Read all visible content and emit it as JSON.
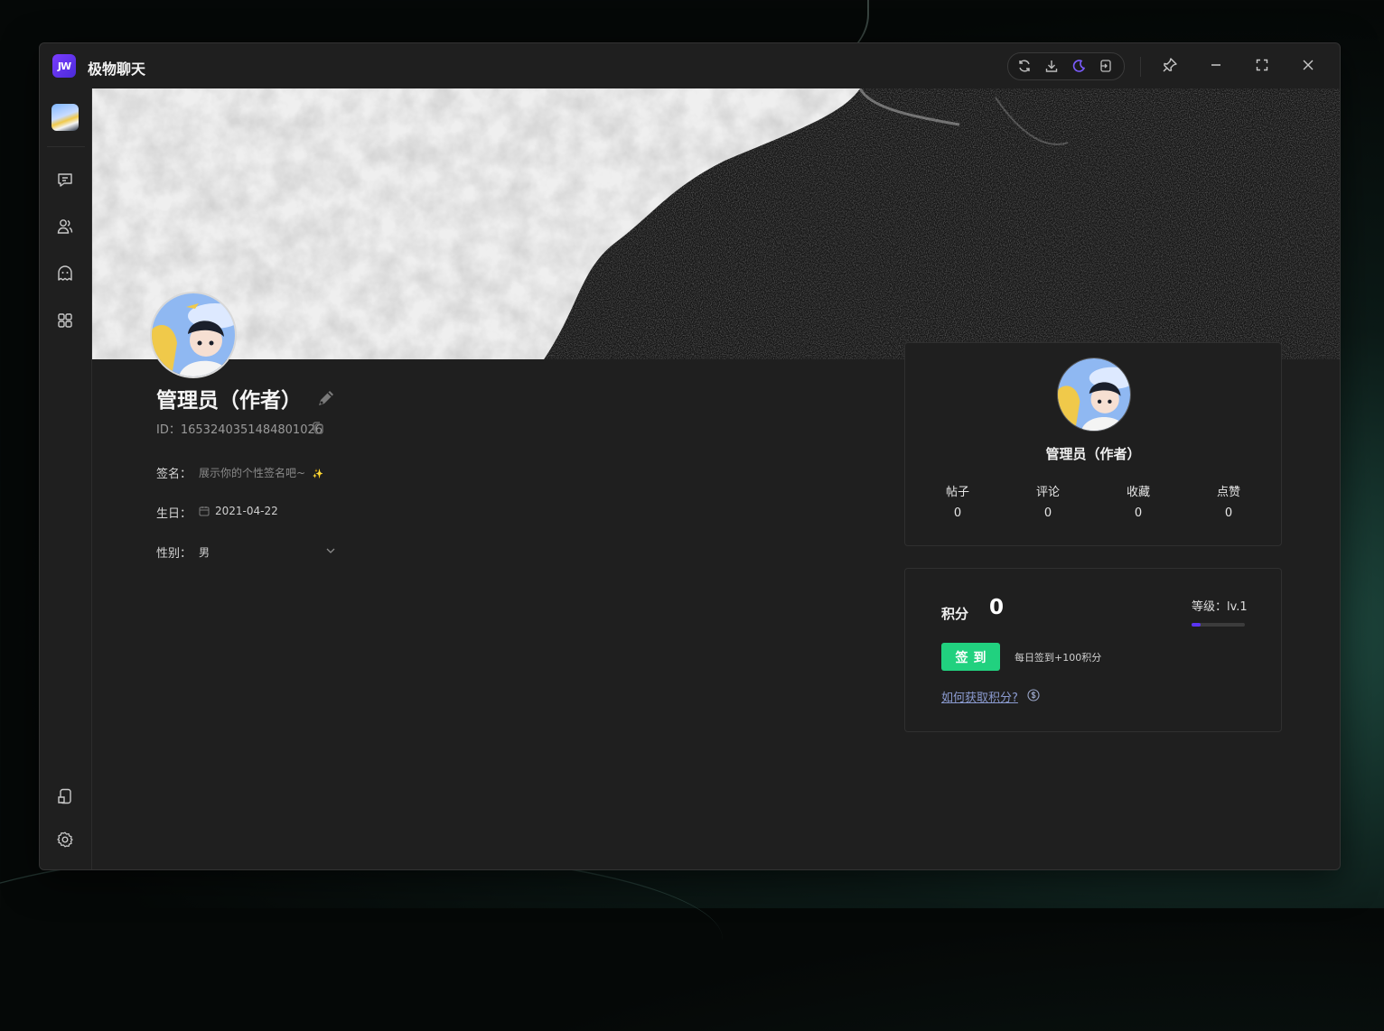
{
  "app": {
    "logo_text": "JW",
    "title": "极物聊天"
  },
  "titlebar": {
    "icons": [
      "refresh-icon",
      "download-icon",
      "moon-icon",
      "layout-icon",
      "pin-icon",
      "minimize-icon",
      "maximize-icon",
      "close-icon"
    ],
    "accent": "#7b5cff"
  },
  "sidebar": {
    "icons": [
      "chat-icon",
      "contacts-icon",
      "ghost-icon",
      "apps-icon",
      "device-icon",
      "settings-icon"
    ]
  },
  "profile": {
    "name": "管理员（作者）",
    "id_label": "ID：",
    "id_value": "1653240351484801026",
    "signature_label": "签名：",
    "signature_placeholder": "展示你的个性签名吧~",
    "signature_emoji": "✨",
    "birthday_label": "生日：",
    "birthday_value": "2021-04-22",
    "gender_label": "性别：",
    "gender_value": "男"
  },
  "card": {
    "name": "管理员（作者）",
    "stats": [
      {
        "label": "帖子",
        "value": "0"
      },
      {
        "label": "评论",
        "value": "0"
      },
      {
        "label": "收藏",
        "value": "0"
      },
      {
        "label": "点赞",
        "value": "0"
      }
    ]
  },
  "points": {
    "label": "积分",
    "value": "0",
    "level_text": "等级：lv.1",
    "level_progress": 0.17,
    "signin_label": "签到",
    "signin_tip": "每日签到+100积分",
    "how_link": "如何获取积分?",
    "signin_color": "#21d17f"
  }
}
